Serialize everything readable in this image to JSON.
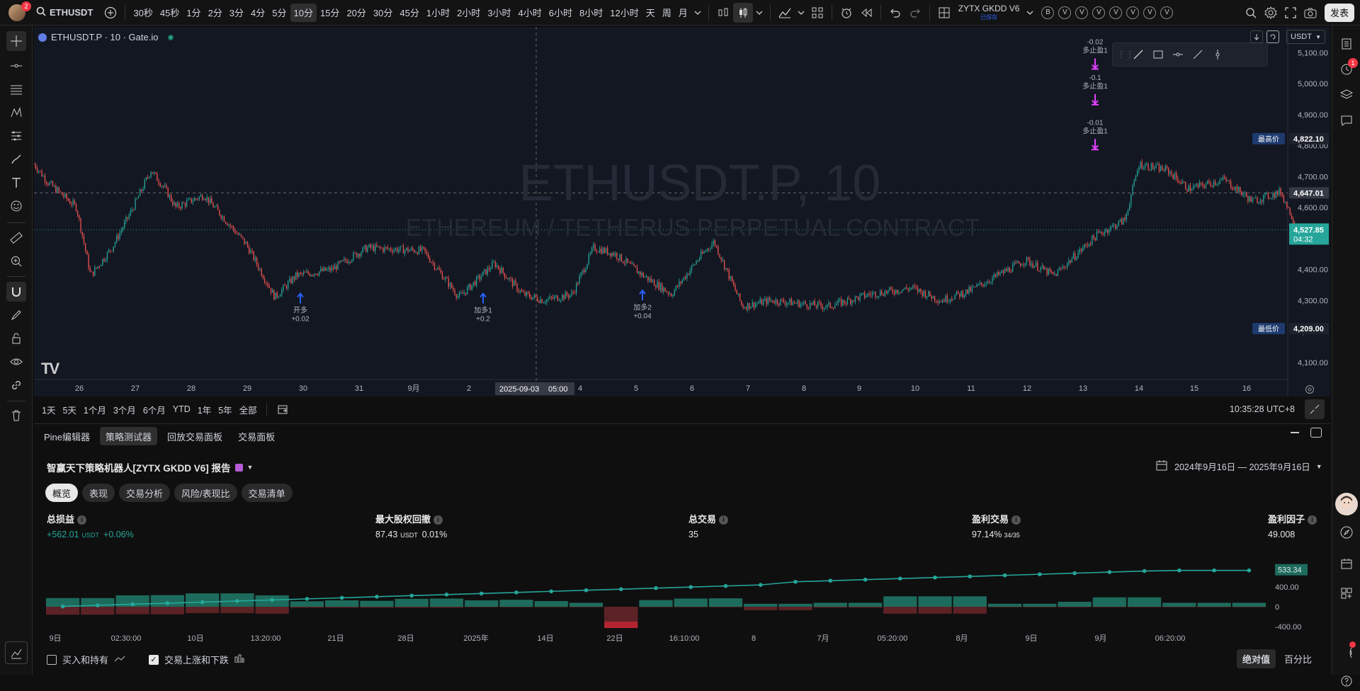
{
  "topbar": {
    "symbol": "ETHUSDT",
    "avatar_badge": "2",
    "intervals": [
      "30秒",
      "45秒",
      "1分",
      "2分",
      "3分",
      "4分",
      "5分",
      "10分",
      "15分",
      "20分",
      "30分",
      "45分",
      "1小时",
      "2小时",
      "3小时",
      "4小时",
      "6小时",
      "8小时",
      "12小时",
      "天",
      "周",
      "月"
    ],
    "active_interval": "10分",
    "indicator_name": "ZYTX GKDD V6",
    "indicator_sub": "已保存",
    "settings_circles": [
      "B",
      "V",
      "V",
      "V",
      "V",
      "V",
      "V",
      "V"
    ],
    "publish_button": "发表"
  },
  "chart": {
    "title": "ETHUSDT.P · 10 · Gate.io",
    "watermark_main": "ETHUSDT.P, 10",
    "watermark_sub": "ETHEREUM / TETHERUS PERPETUAL CONTRACT",
    "currency": "USDT",
    "price_ticks": [
      "5,100.00",
      "5,000.00",
      "4,900.00",
      "4,800.00",
      "4,700.00",
      "4,600.00",
      "4,500.00",
      "4,400.00",
      "4,300.00",
      "4,200.00",
      "4,100.00"
    ],
    "high_label": "最高价",
    "high_value": "4,822.10",
    "low_label": "最低价",
    "low_value": "4,209.00",
    "crosshair_price": "4,647.01",
    "last_price": "4,527.85",
    "countdown": "04:32",
    "date_ticks": [
      "26",
      "27",
      "28",
      "29",
      "30",
      "31",
      "9月",
      "2",
      "4",
      "5",
      "6",
      "7",
      "8",
      "9",
      "10",
      "11",
      "12",
      "13",
      "14",
      "15",
      "16"
    ],
    "crosshair_date": "2025-09-03",
    "crosshair_time": "05:00",
    "logo": "TV",
    "markers": [
      {
        "label": "开多",
        "value": "+0.02",
        "color": "#2962ff",
        "dir": "up"
      },
      {
        "label": "加多1",
        "value": "+0.2",
        "color": "#2962ff",
        "dir": "up"
      },
      {
        "label": "加多2",
        "value": "+0.04",
        "color": "#2962ff",
        "dir": "up"
      },
      {
        "label": "多止盈1",
        "value": "-0.02",
        "color": "#e040fb",
        "dir": "down"
      },
      {
        "label": "多止盈1",
        "value": "-0.1",
        "color": "#e040fb",
        "dir": "down"
      },
      {
        "label": "多止盈1",
        "value": "-0.01",
        "color": "#e040fb",
        "dir": "down"
      }
    ]
  },
  "rangebar": {
    "ranges": [
      "1天",
      "5天",
      "1个月",
      "3个月",
      "6个月",
      "YTD",
      "1年",
      "5年",
      "全部"
    ],
    "clock": "10:35:28 UTC+8"
  },
  "panel": {
    "tabs": [
      "Pine编辑器",
      "策略测试器",
      "回放交易面板",
      "交易面板"
    ],
    "active_tab": "策略测试器",
    "report_title": "智赢天下策略机器人[ZYTX GKDD V6] 报告",
    "date_range": "2024年9月16日 — 2025年9月16日",
    "subtabs": [
      "概览",
      "表现",
      "交易分析",
      "风险/表现比",
      "交易清单"
    ],
    "active_subtab": "概览",
    "metrics": [
      {
        "label": "总损益",
        "value": "+562.01",
        "unit": "USDT",
        "extra": "+0.06%",
        "green": true
      },
      {
        "label": "最大股权回撤",
        "value": "87.43",
        "unit": "USDT",
        "extra": "0.01%",
        "green": false
      },
      {
        "label": "总交易",
        "value": "35",
        "unit": "",
        "extra": "",
        "green": false
      },
      {
        "label": "盈利交易",
        "value": "97.14%",
        "unit": "",
        "extra": "34/35",
        "green": false
      },
      {
        "label": "盈利因子",
        "value": "49.008",
        "unit": "",
        "extra": "",
        "green": false
      }
    ],
    "equity_axis": [
      "400.00",
      "0",
      "-400.00"
    ],
    "equity_last": "533.34",
    "equity_x_ticks": [
      "9日",
      "02:30:00",
      "10日",
      "13:20:00",
      "21日",
      "28日",
      "2025年",
      "14日",
      "22日",
      "16:10:00",
      "8",
      "7月",
      "05:20:00",
      "8月",
      "9日",
      "9月",
      "06:20:00"
    ],
    "checkbox_buyhold": "买入和持有",
    "checkbox_updown": "交易上涨和下跌",
    "toggle_abs": "绝对值",
    "toggle_pct": "百分比"
  },
  "colors": {
    "up": "#26a69a",
    "down": "#ef5350",
    "buy_marker": "#2962ff",
    "sell_marker": "#e040fb",
    "last_price_bg": "#26a69a"
  }
}
